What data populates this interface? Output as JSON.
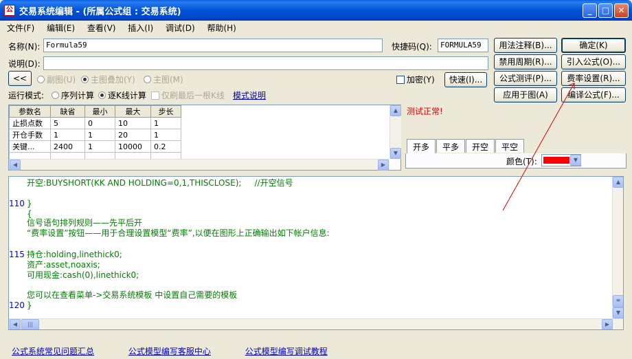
{
  "title_bar": {
    "icon_text": "公",
    "title": "交易系统编辑 - (所属公式组 : 交易系统)"
  },
  "menu": [
    "文件(F)",
    "编辑(E)",
    "查看(V)",
    "插入(I)",
    "调试(D)",
    "帮助(H)"
  ],
  "form": {
    "name_label": "名称(N):",
    "name_value": "Formula59",
    "hotkey_label": "快捷码(Q):",
    "hotkey_value": "FORMULA59",
    "desc_label": "说明(D):",
    "desc_value": "",
    "collapse": "<<",
    "mode_sub": "副图(U)",
    "mode_overlay": "主图叠加(Y)",
    "mode_main": "主图(M)",
    "password": "加密(Y)",
    "fast": "快速(I)...",
    "run_mode_label": "运行模式:",
    "run_seq": "序列计算",
    "run_bar": "逐K线计算",
    "last_bar_only": "仅刷最后一根K线",
    "mode_help": "模式说明"
  },
  "buttons": {
    "usage": "用法注释(B)...",
    "ok": "确定(K)",
    "disable_period": "禁用周期(R)...",
    "import": "引入公式(O)...",
    "test": "公式测评(P)...",
    "fee": "费率设置(R)...",
    "apply": "应用于图(A)",
    "compile": "编译公式(F)..."
  },
  "params": {
    "headers": [
      "参数名",
      "缺省",
      "最小",
      "最大",
      "步长"
    ],
    "rows": [
      [
        "止损点数",
        "5",
        "0",
        "10",
        "1"
      ],
      [
        "开仓手数",
        "1",
        "1",
        "20",
        "1"
      ],
      [
        "关键...",
        "2400",
        "1",
        "10000",
        "0.2"
      ]
    ]
  },
  "status": "测试正常!",
  "signal_tabs": [
    "开多",
    "平多",
    "开空",
    "平空"
  ],
  "color_label": "颜色(T):",
  "color_value": "#ff0000",
  "code_lines": [
    {
      "ln": "",
      "text": "开空:BUYSHORT(KK AND HOLDING=0,1,THISCLOSE);     //开空信号"
    },
    {
      "ln": "",
      "text": ""
    },
    {
      "ln": "110",
      "text": "}"
    },
    {
      "ln": "",
      "text": "{"
    },
    {
      "ln": "",
      "text": "信号语句排列规则——先平后开"
    },
    {
      "ln": "",
      "text": "“费率设置”按钮——用于合理设置模型“费率”,以便在图形上正确输出如下帐户信息:"
    },
    {
      "ln": "",
      "text": ""
    },
    {
      "ln": "115",
      "text": "持仓:holding,linethick0;"
    },
    {
      "ln": "",
      "text": "资产:asset,noaxis;"
    },
    {
      "ln": "",
      "text": "可用现金:cash(0),linethick0;"
    },
    {
      "ln": "",
      "text": ""
    },
    {
      "ln": "",
      "text": "您可以在查看菜单->交易系统模板 中设置自己需要的模板"
    },
    {
      "ln": "120",
      "text": "}"
    }
  ],
  "bottom_links": [
    "公式系统常见问题汇总",
    "公式模型编写客服中心",
    "公式模型编写调试教程"
  ]
}
